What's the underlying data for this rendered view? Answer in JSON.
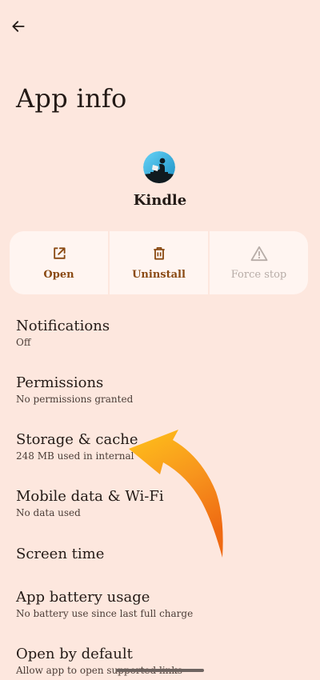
{
  "header": {
    "title": "App info"
  },
  "app": {
    "name": "Kindle"
  },
  "actions": {
    "open": "Open",
    "uninstall": "Uninstall",
    "force_stop": "Force stop"
  },
  "settings": {
    "items": [
      {
        "title": "Notifications",
        "subtitle": "Off"
      },
      {
        "title": "Permissions",
        "subtitle": "No permissions granted"
      },
      {
        "title": "Storage & cache",
        "subtitle": "248 MB used in internal"
      },
      {
        "title": "Mobile data & Wi-Fi",
        "subtitle": "No data used"
      },
      {
        "title": "Screen time",
        "subtitle": ""
      },
      {
        "title": "App battery usage",
        "subtitle": "No battery use since last full charge"
      },
      {
        "title": "Open by default",
        "subtitle": "Allow app to open supported links"
      }
    ]
  },
  "colors": {
    "background": "#fde7de",
    "card": "#fff5f1",
    "accent": "#8a4a13",
    "disabled": "#b7aca7",
    "annotation_arrow": "#f7941d"
  },
  "icons": {
    "back": "arrow-left-icon",
    "open": "open-external-icon",
    "uninstall": "trash-icon",
    "force_stop": "warning-triangle-icon"
  }
}
